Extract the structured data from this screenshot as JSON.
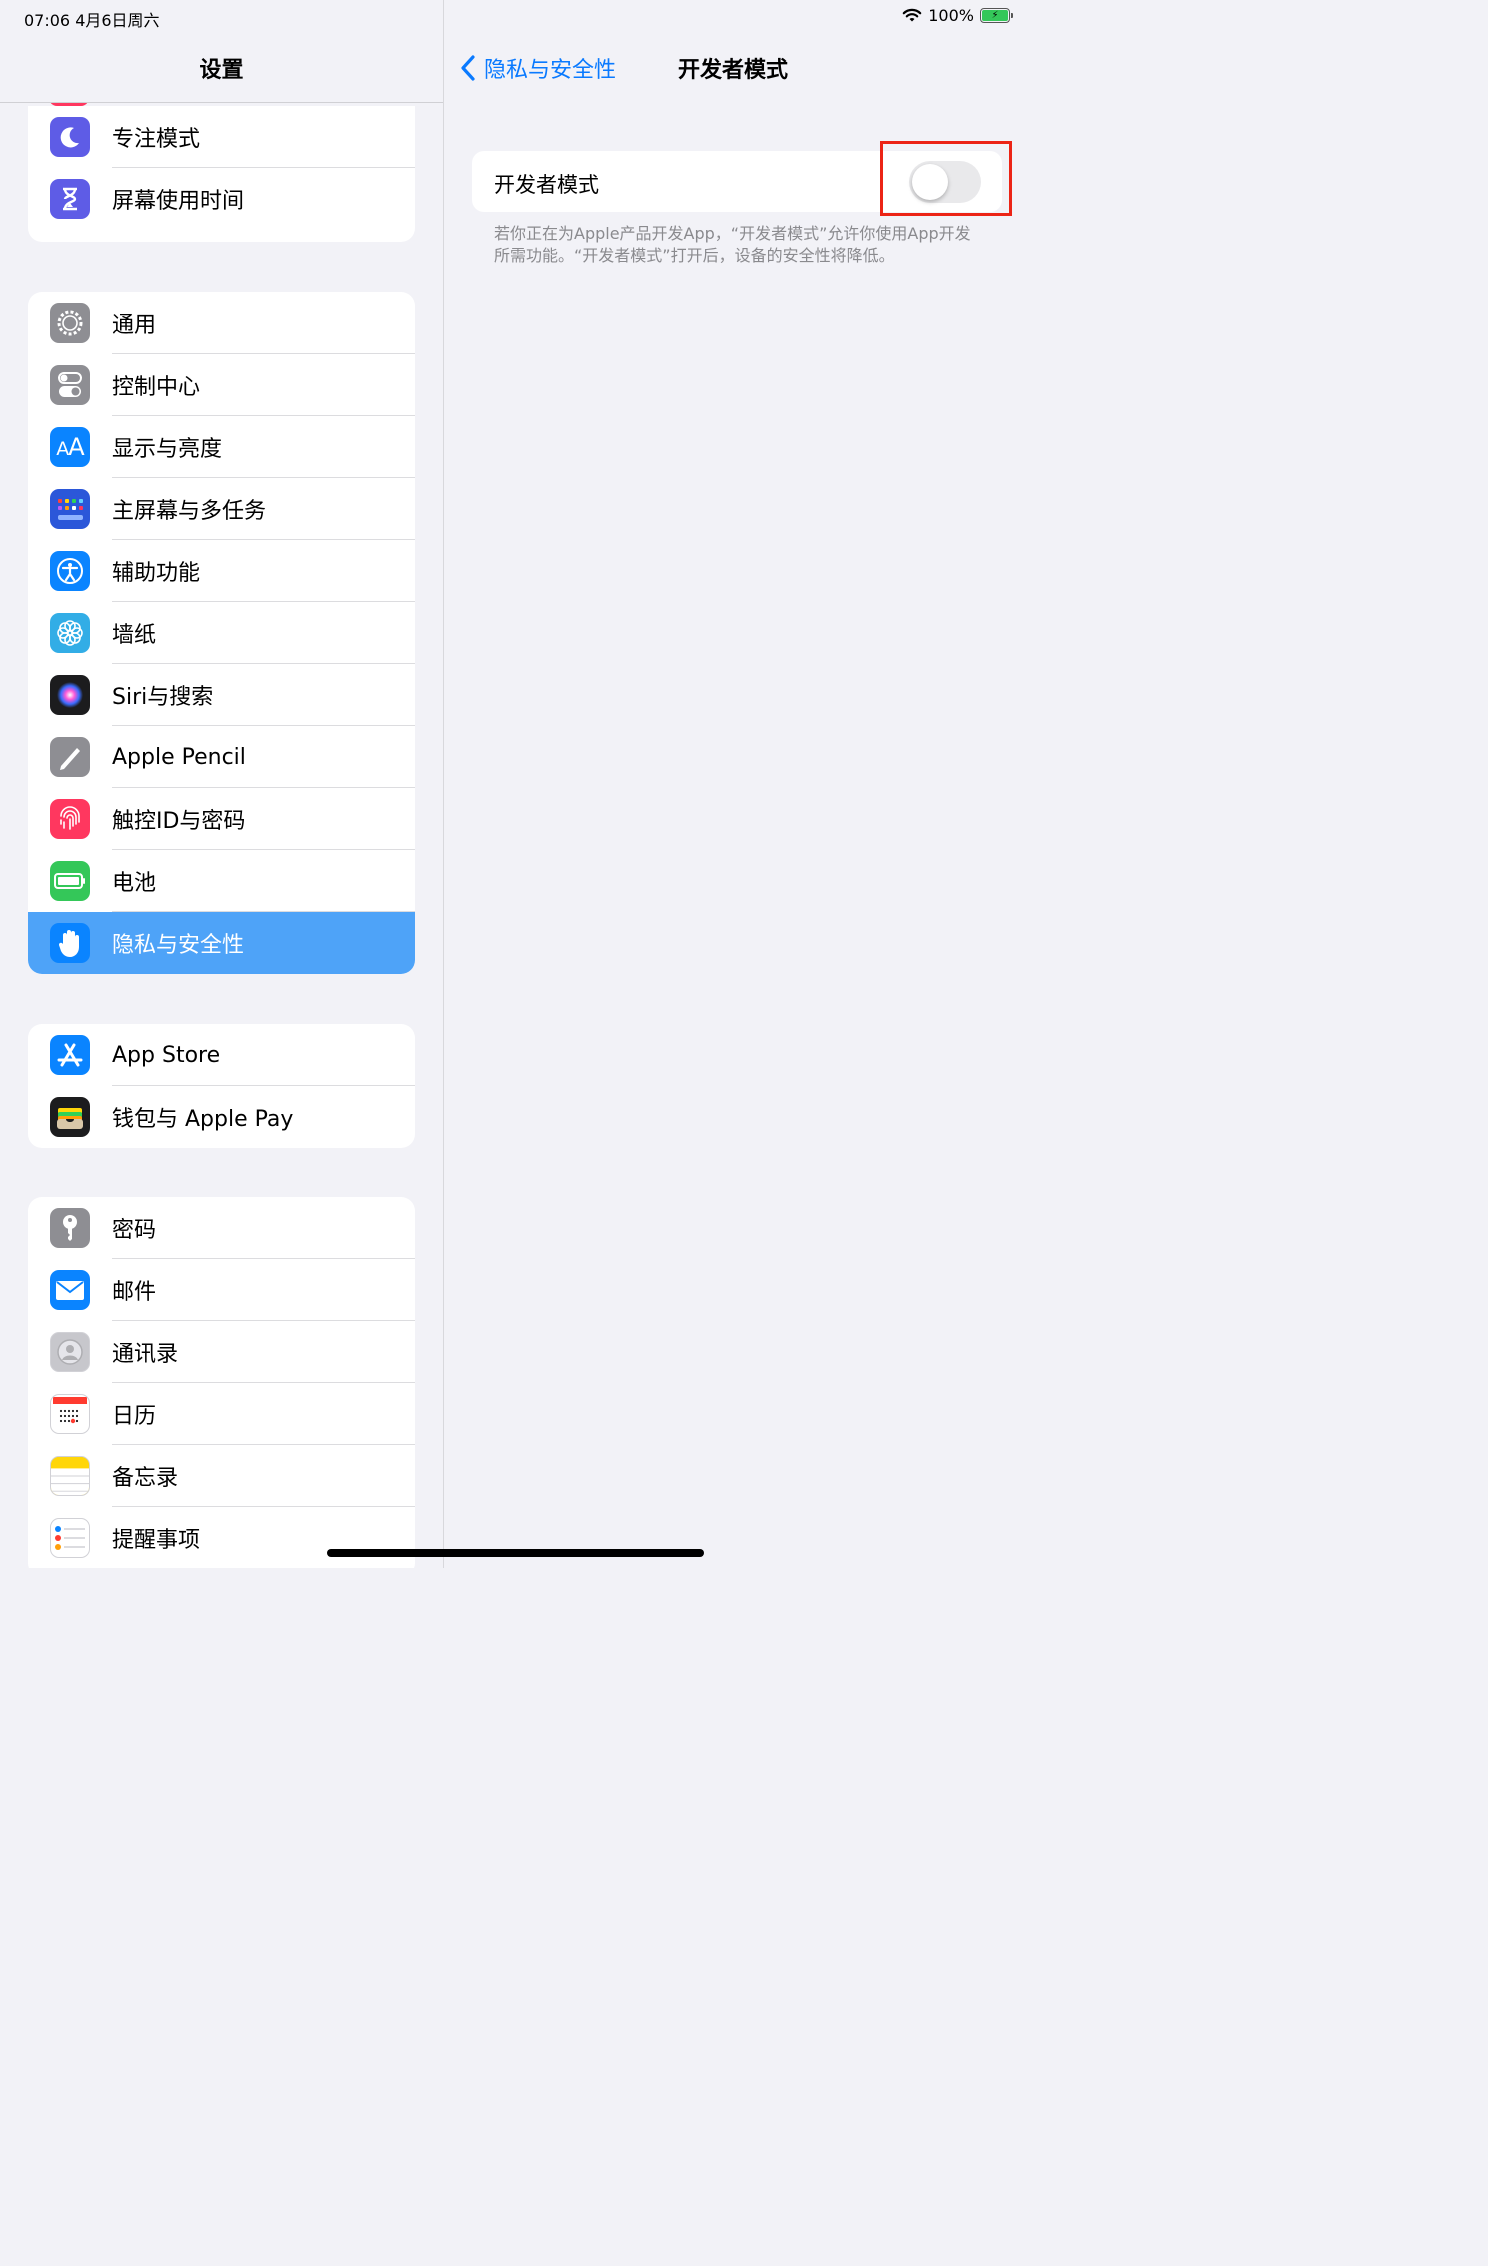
{
  "status_bar": {
    "time_date": "07:06   4月6日周六",
    "battery": "100%",
    "wifi_icon": "wifi-icon",
    "battery_icon": "battery-charging-icon"
  },
  "sidebar": {
    "title": "设置",
    "group1": [
      {
        "label": "专注模式",
        "icon": "moon-icon",
        "color": "#5e5ce6"
      },
      {
        "label": "屏幕使用时间",
        "icon": "hourglass-icon",
        "color": "#5e5ce6"
      }
    ],
    "group2": [
      {
        "label": "通用",
        "icon": "gear-icon",
        "color": "#8e8e93"
      },
      {
        "label": "控制中心",
        "icon": "toggles-icon",
        "color": "#8e8e93"
      },
      {
        "label": "显示与亮度",
        "icon": "text-size-icon",
        "color": "#0a84ff"
      },
      {
        "label": "主屏幕与多任务",
        "icon": "app-grid-icon",
        "color": "#2b57d9"
      },
      {
        "label": "辅助功能",
        "icon": "accessibility-icon",
        "color": "#0a84ff"
      },
      {
        "label": "墙纸",
        "icon": "flower-icon",
        "color": "#32ade6"
      },
      {
        "label": "Siri与搜索",
        "icon": "siri-icon",
        "color": "#1c1c1e"
      },
      {
        "label": "Apple Pencil",
        "icon": "pencil-icon",
        "color": "#8e8e93"
      },
      {
        "label": "触控ID与密码",
        "icon": "fingerprint-icon",
        "color": "#ff375f"
      },
      {
        "label": "电池",
        "icon": "battery-icon",
        "color": "#34c759"
      },
      {
        "label": "隐私与安全性",
        "icon": "hand-icon",
        "color": "#0a84ff",
        "selected": true
      }
    ],
    "group3": [
      {
        "label": "App Store",
        "icon": "app-store-icon",
        "color": "#0a84ff"
      },
      {
        "label": "钱包与 Apple Pay",
        "icon": "wallet-icon",
        "color": "#1c1c1e"
      }
    ],
    "group4": [
      {
        "label": "密码",
        "icon": "key-icon",
        "color": "#8e8e93"
      },
      {
        "label": "邮件",
        "icon": "mail-icon",
        "color": "#0a84ff"
      },
      {
        "label": "通讯录",
        "icon": "contacts-icon",
        "color": "#c7c7cc"
      },
      {
        "label": "日历",
        "icon": "calendar-icon",
        "color": "#ffffff"
      },
      {
        "label": "备忘录",
        "icon": "notes-icon",
        "color": "#ffd60a"
      },
      {
        "label": "提醒事项",
        "icon": "reminders-icon",
        "color": "#ffffff"
      }
    ],
    "selection_color": "#4ea3f8"
  },
  "detail": {
    "back_label": "隐私与安全性",
    "title": "开发者模式",
    "setting_label": "开发者模式",
    "toggle_on": false,
    "footnote": "若你正在为Apple产品开发App，“开发者模式”允许你使用App开发所需功能。“开发者模式”打开后，设备的安全性将降低。",
    "accent_color": "#0a7aff",
    "highlight_color": "#ec2416"
  }
}
